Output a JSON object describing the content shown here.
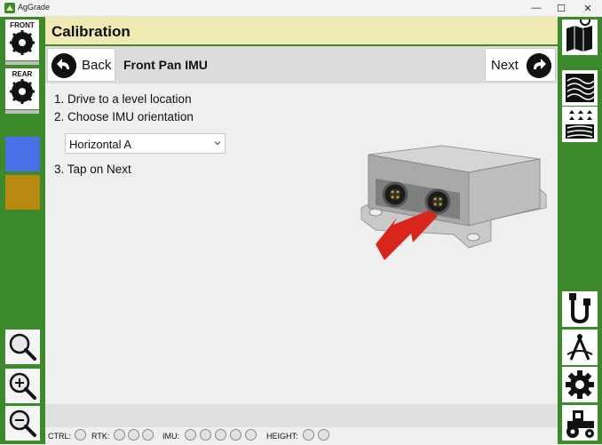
{
  "window": {
    "title": "AgGrade",
    "minimize_glyph": "—",
    "maximize_glyph": "☐",
    "close_glyph": "✕"
  },
  "header": {
    "title": "Calibration"
  },
  "toolbar": {
    "back_label": "Back",
    "page_name": "Front Pan IMU",
    "next_label": "Next"
  },
  "steps": {
    "step1": "1. Drive to a level location",
    "step2": "2. Choose IMU orientation",
    "step3": "3. Tap on Next"
  },
  "orientation_select": {
    "selected": "Horizontal A"
  },
  "left_sidebar": {
    "front_label": "FRONT",
    "rear_label": "REAR",
    "swatch_colors": [
      "#4a72e8",
      "#b98a10"
    ]
  },
  "status": {
    "ctrl_label": "CTRL:",
    "rtk_label": "RTK:",
    "imu_label": "IMU:",
    "height_label": "HEIGHT:"
  },
  "colors": {
    "frame_green": "#3d8a2c",
    "header_yellow": "#efe9b3",
    "arrow_red": "#d8261c"
  },
  "icons": {
    "right_sidebar": [
      "map-pin-icon",
      "contour-map-icon",
      "field-crop-icon",
      "cable-connector-icon",
      "compass-survey-icon",
      "gear-icon",
      "tractor-icon"
    ],
    "left_sidebar": [
      "front-pan-blade-icon",
      "rear-pan-blade-icon",
      "zoom-fit-icon",
      "zoom-in-icon",
      "zoom-out-icon"
    ]
  }
}
